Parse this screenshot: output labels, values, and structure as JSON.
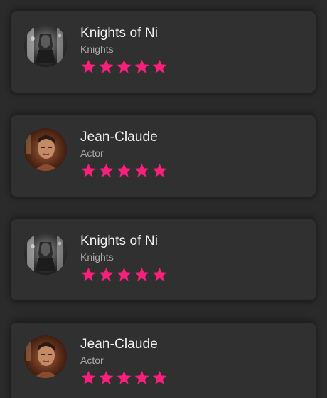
{
  "accent_color": "#ff1f7d",
  "cards": [
    {
      "name": "Knights of Ni",
      "subtitle": "Knights",
      "rating": 5,
      "avatar_icon": "knight-portrait"
    },
    {
      "name": "Jean-Claude",
      "subtitle": "Actor",
      "rating": 5,
      "avatar_icon": "actor-portrait"
    },
    {
      "name": "Knights of Ni",
      "subtitle": "Knights",
      "rating": 5,
      "avatar_icon": "knight-portrait"
    },
    {
      "name": "Jean-Claude",
      "subtitle": "Actor",
      "rating": 5,
      "avatar_icon": "actor-portrait"
    }
  ]
}
